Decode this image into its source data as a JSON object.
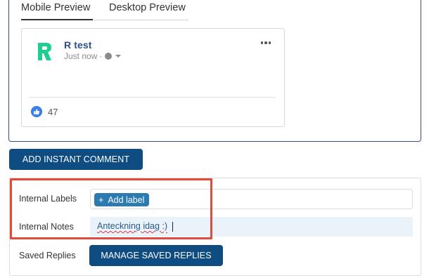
{
  "tabs": [
    {
      "label": "Mobile Preview",
      "active": true
    },
    {
      "label": "Desktop Preview",
      "active": false
    }
  ],
  "post": {
    "author": "R test",
    "time": "Just now",
    "separator": "·",
    "likes": "47"
  },
  "actions": {
    "add_instant_comment": "ADD INSTANT COMMENT",
    "manage_saved_replies": "MANAGE SAVED REPLIES"
  },
  "fields": {
    "internal_labels": "Internal Labels",
    "add_label": "Add label",
    "add_label_symbol": "+",
    "internal_notes": "Internal Notes",
    "notes_value": "Anteckning idag :)",
    "saved_replies": "Saved Replies"
  },
  "colors": {
    "primary": "#0f4c81",
    "accent": "#2b7bb0",
    "highlight": "#e24b3c",
    "brand_logo": "#1fcf8f",
    "like": "#3a7ef0"
  },
  "icons": [
    "brand-logo-icon",
    "globe-icon",
    "caret-down-icon",
    "more-horizontal-icon",
    "thumbs-up-icon",
    "plus-icon"
  ]
}
